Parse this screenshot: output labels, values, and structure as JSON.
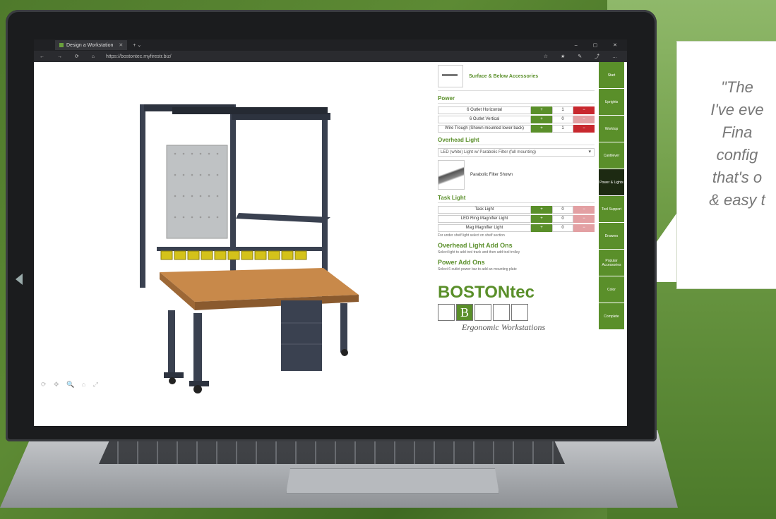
{
  "browser": {
    "tab_title": "Design a Workstation",
    "url": "https://bostontec.myfirestr.biz/"
  },
  "selection": {
    "title": "Surface & Below Accessories"
  },
  "power": {
    "heading": "Power",
    "items": [
      {
        "label": "6 Outlet Horizontal",
        "qty": "1",
        "plus": "+",
        "minus": "−"
      },
      {
        "label": "6 Outlet Vertical",
        "qty": "0",
        "plus": "+",
        "minus": "−"
      },
      {
        "label": "Wire Trough (Shown mounted lower back)",
        "qty": "1",
        "plus": "+",
        "minus": "−"
      }
    ]
  },
  "overhead": {
    "heading": "Overhead Light",
    "dropdown": "LED (white) Light w/ Parabolic Filter (full mounting)",
    "thumb_caption": "Parabolic Filter Shown"
  },
  "task": {
    "heading": "Task Light",
    "items": [
      {
        "label": "Task Light",
        "qty": "0",
        "plus": "+",
        "minus": "−"
      },
      {
        "label": "LED Ring Magnifier Light",
        "qty": "0",
        "plus": "+",
        "minus": "−"
      },
      {
        "label": "Mag Magnifier Light",
        "qty": "0",
        "plus": "+",
        "minus": "−"
      }
    ],
    "note": "For under shelf light select on shelf section"
  },
  "overhead_addons": {
    "heading": "Overhead Light Add Ons",
    "note": "Select light to add tool track and then add tool trolley"
  },
  "power_addons": {
    "heading": "Power Add Ons",
    "note": "Select 6 outlet power bar to add an mounting plate"
  },
  "logo": {
    "brand": "BOSTONtec",
    "box_letter": "B",
    "tagline": "Ergonomic Workstations"
  },
  "side_tabs": [
    "Start",
    "Uprights",
    "Worktop",
    "Cantilever",
    "Power & Lights",
    "Tool Support",
    "Drawers",
    "Popular Accessories",
    "Color",
    "Complete"
  ],
  "active_side_tab": "Power & Lights",
  "viewer_tools": {
    "glyphs": "⟳ ✥ 🔍 ⌂ ⤢"
  },
  "quote": {
    "lines": [
      "\"The",
      "I've eve",
      "Fina",
      "config",
      "that's o",
      "& easy t"
    ]
  },
  "colors": {
    "brand_green": "#5a8f2a",
    "minus_red": "#c8282e",
    "active_tab": "#1d2a12"
  }
}
